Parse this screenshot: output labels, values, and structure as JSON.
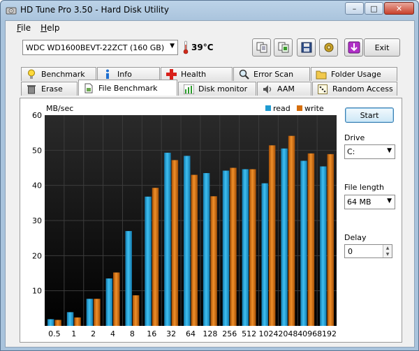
{
  "window": {
    "title": "HD Tune Pro 3.50 - Hard Disk Utility",
    "min_label": "–",
    "max_label": "□",
    "close_label": "✕"
  },
  "menu": {
    "file_first": "F",
    "file_rest": "ile",
    "help_first": "H",
    "help_rest": "elp"
  },
  "toolbar": {
    "drive": "WDC WD1600BEVT-22ZCT (160 GB)",
    "temperature": "39°C",
    "exit_label": "Exit",
    "buttons": [
      "copy-text-icon",
      "copy-screenshot-icon",
      "save-icon",
      "options-icon",
      "download-icon"
    ]
  },
  "tabs": {
    "row1": [
      {
        "label": "Benchmark",
        "icon": "lightbulb-icon"
      },
      {
        "label": "Info",
        "icon": "info-icon"
      },
      {
        "label": "Health",
        "icon": "health-cross-icon"
      },
      {
        "label": "Error Scan",
        "icon": "magnifier-icon"
      },
      {
        "label": "Folder Usage",
        "icon": "folder-icon"
      }
    ],
    "row2": [
      {
        "label": "Erase",
        "icon": "trash-icon"
      },
      {
        "label": "File Benchmark",
        "icon": "file-icon"
      },
      {
        "label": "Disk monitor",
        "icon": "bar-chart-icon"
      },
      {
        "label": "AAM",
        "icon": "speaker-icon"
      },
      {
        "label": "Random Access",
        "icon": "dice-icon"
      }
    ]
  },
  "controls": {
    "start_label": "Start",
    "drive_label": "Drive",
    "drive_value": "C:",
    "file_length_label": "File length",
    "file_length_value": "64 MB",
    "delay_label": "Delay",
    "delay_value": "0"
  },
  "colors": {
    "read": "#1f9bd1",
    "write": "#d56e0c",
    "plot_bg": "#000000"
  },
  "chart_data": {
    "type": "bar",
    "ylabel": "MB/sec",
    "ylim": [
      0,
      60
    ],
    "yticks": [
      10,
      20,
      30,
      40,
      50,
      60
    ],
    "grid": true,
    "legend_position": "top-right",
    "categories": [
      "0.5",
      "1",
      "2",
      "4",
      "8",
      "16",
      "32",
      "64",
      "128",
      "256",
      "512",
      "1024",
      "2048",
      "4096",
      "8192"
    ],
    "series": [
      {
        "name": "read",
        "values": [
          1.9,
          3.9,
          7.7,
          13.5,
          27.0,
          36.8,
          49.3,
          48.4,
          43.5,
          44.2,
          44.6,
          40.6,
          50.5,
          47.0,
          45.4
        ]
      },
      {
        "name": "write",
        "values": [
          1.7,
          2.4,
          7.7,
          15.2,
          8.7,
          39.3,
          47.2,
          43.0,
          36.9,
          45.0,
          44.6,
          51.4,
          54.1,
          49.1,
          48.9
        ]
      }
    ]
  }
}
